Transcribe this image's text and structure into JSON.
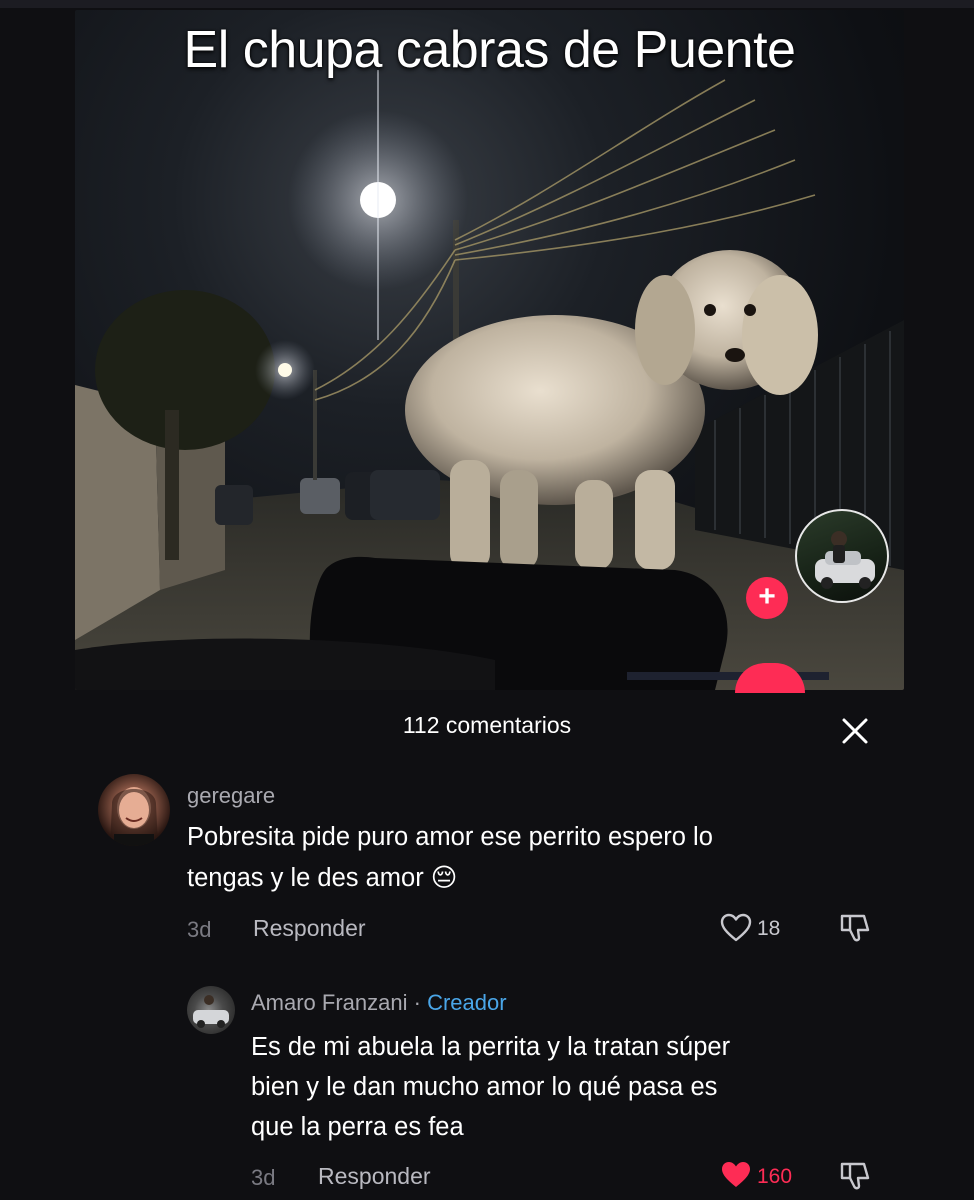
{
  "video": {
    "title": "El chupa cabras de Puente",
    "follow_symbol": "+"
  },
  "comments_panel": {
    "count_label": "112 comentarios",
    "close_icon": "close-icon"
  },
  "comments": [
    {
      "username": "geregare",
      "text_line1": "Pobresita pide puro amor ese perrito espero lo",
      "text_line2": "tengas y le des amor 😔",
      "time": "3d",
      "reply_label": "Responder",
      "likes": "18",
      "liked": false
    },
    {
      "username": "Amaro Franzani",
      "separator": "·",
      "creator_tag": "Creador",
      "text_line1": "Es de mi abuela la perrita y la tratan súper",
      "text_line2": "bien y le dan mucho amor lo qué pasa es",
      "text_line3": "que la perra es fea",
      "time": "3d",
      "reply_label": "Responder",
      "likes": "160",
      "liked": true
    }
  ],
  "colors": {
    "accent": "#fe2c55",
    "creator": "#4aa6e8",
    "background": "#0f0f12"
  }
}
